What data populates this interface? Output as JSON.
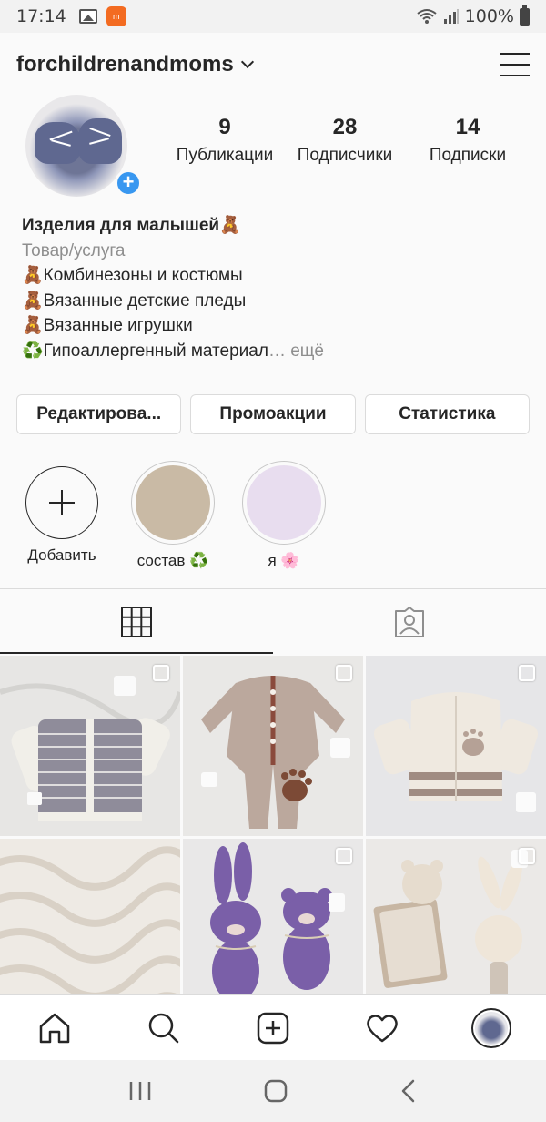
{
  "status_bar": {
    "time": "17:14",
    "battery": "100%",
    "app_badge": "m"
  },
  "header": {
    "username": "forchildrenandmoms"
  },
  "profile": {
    "stats": [
      {
        "value": "9",
        "label": "Публикации"
      },
      {
        "value": "28",
        "label": "Подписчики"
      },
      {
        "value": "14",
        "label": "Подписки"
      }
    ],
    "bio": {
      "name": "Изделия для малышей🧸",
      "category": "Товар/услуга",
      "lines": [
        "🧸Комбинезоны и костюмы",
        "🧸Вязанные детские пледы",
        "🧸Вязанные игрушки",
        "♻️Гипоаллергенный материал"
      ],
      "more": "… ещё"
    }
  },
  "buttons": {
    "edit": "Редактирова...",
    "promo": "Промоакции",
    "stats": "Статистика"
  },
  "highlights": [
    {
      "label": "Добавить"
    },
    {
      "label": "состав ♻️",
      "color": "#c9baa5"
    },
    {
      "label": "я 🌸",
      "color": "#e8ddef"
    }
  ],
  "icons": {
    "grid_tab": "grid-icon",
    "tagged_tab": "tagged-person-icon",
    "nav": [
      "home-icon",
      "search-icon",
      "add-post-icon",
      "heart-icon",
      "profile-avatar"
    ]
  },
  "colors": {
    "accent": "#3897f0",
    "text": "#262626",
    "secondary": "#8e8e8e"
  }
}
